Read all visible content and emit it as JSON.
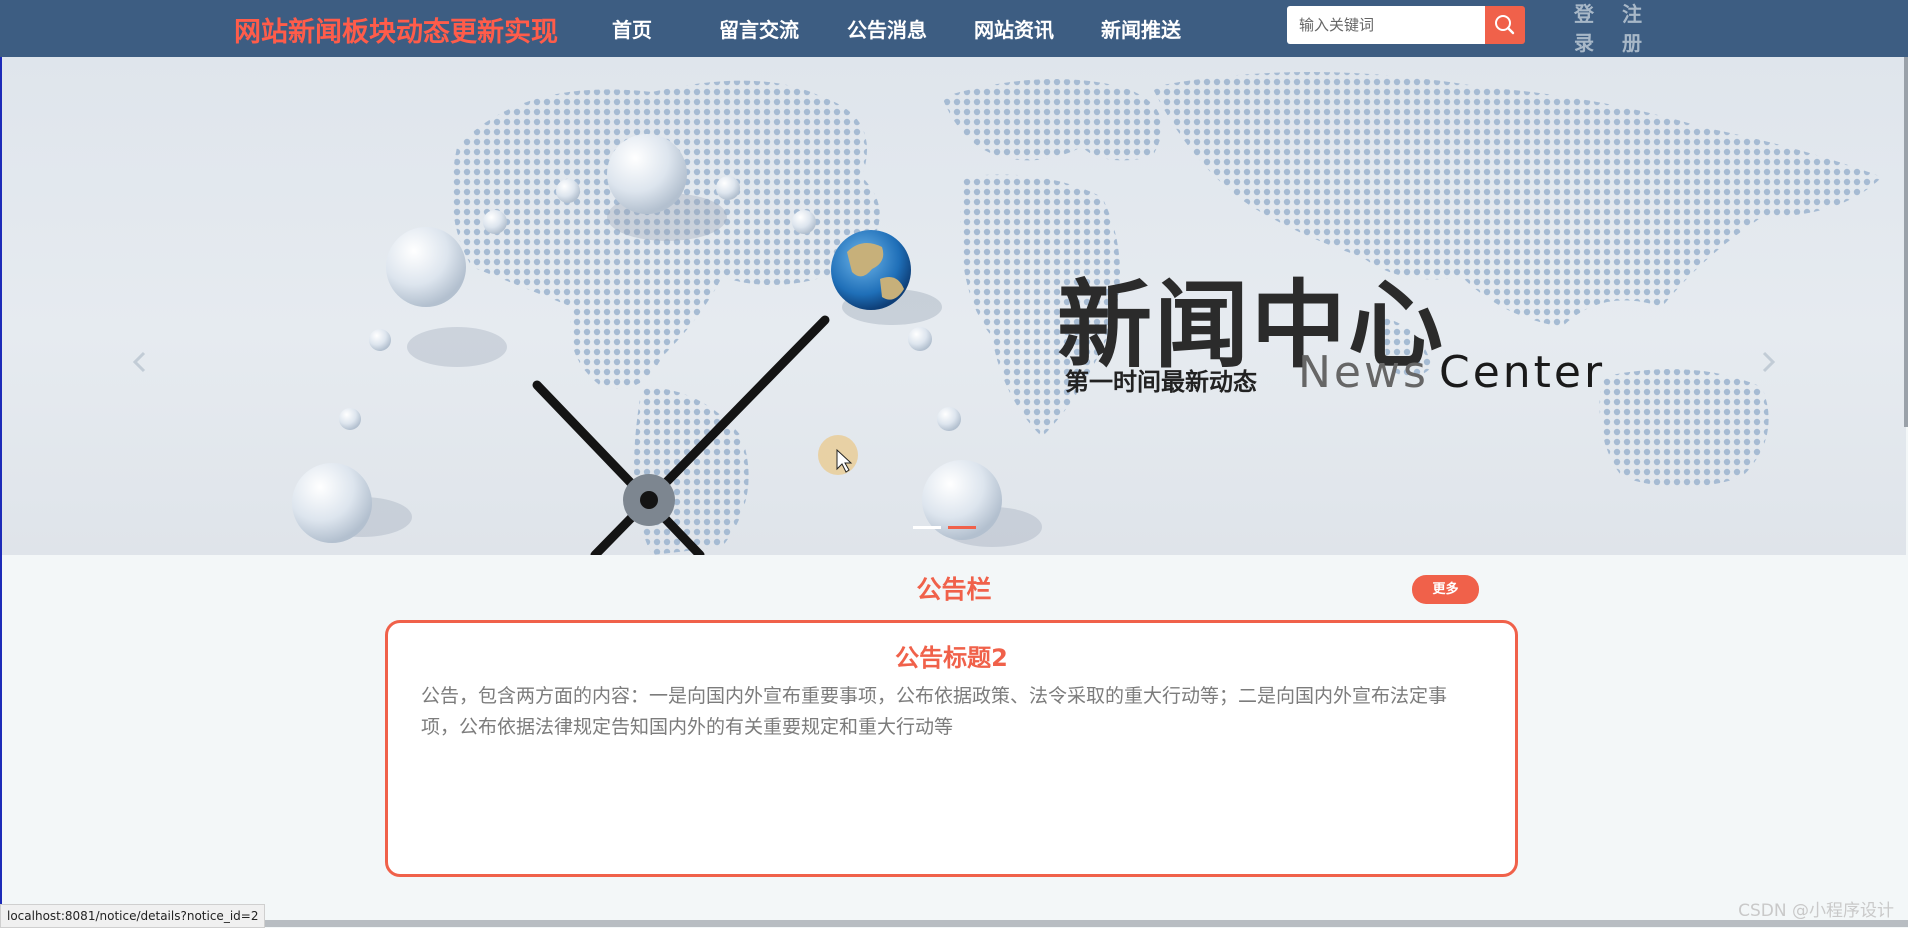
{
  "header": {
    "site_title": "网站新闻板块动态更新实现",
    "nav": [
      {
        "label": "首页"
      },
      {
        "label": "留言交流"
      },
      {
        "label": "公告消息"
      },
      {
        "label": "网站资讯"
      },
      {
        "label": "新闻推送"
      }
    ],
    "search": {
      "placeholder": "输入关键词",
      "icon": "search-icon"
    },
    "auth": {
      "login": [
        "登",
        "录"
      ],
      "register": [
        "注",
        "册"
      ]
    }
  },
  "banner": {
    "headline": "新闻中心",
    "tagline": "第一时间最新动态",
    "english_left": "News",
    "english_right": "Center",
    "slides": 2,
    "active_slide": 2,
    "prev_icon": "chevron-left-icon",
    "next_icon": "chevron-right-icon"
  },
  "notice_section": {
    "title": "公告栏",
    "more_label": "更多",
    "card": {
      "title": "公告标题2",
      "body": "公告，包含两方面的内容：一是向国内外宣布重要事项，公布依据政策、法令采取的重大行动等；二是向国内外宣布法定事项，公布依据法律规定告知国内外的有关重要规定和重大行动等"
    }
  },
  "status_bar": {
    "url": "localhost:8081/notice/details?notice_id=2"
  },
  "watermark": "CSDN @小程序设计",
  "colors": {
    "nav_bg": "#3d5d82",
    "accent": "#f0614a",
    "page_bg": "#f3f7f8"
  }
}
